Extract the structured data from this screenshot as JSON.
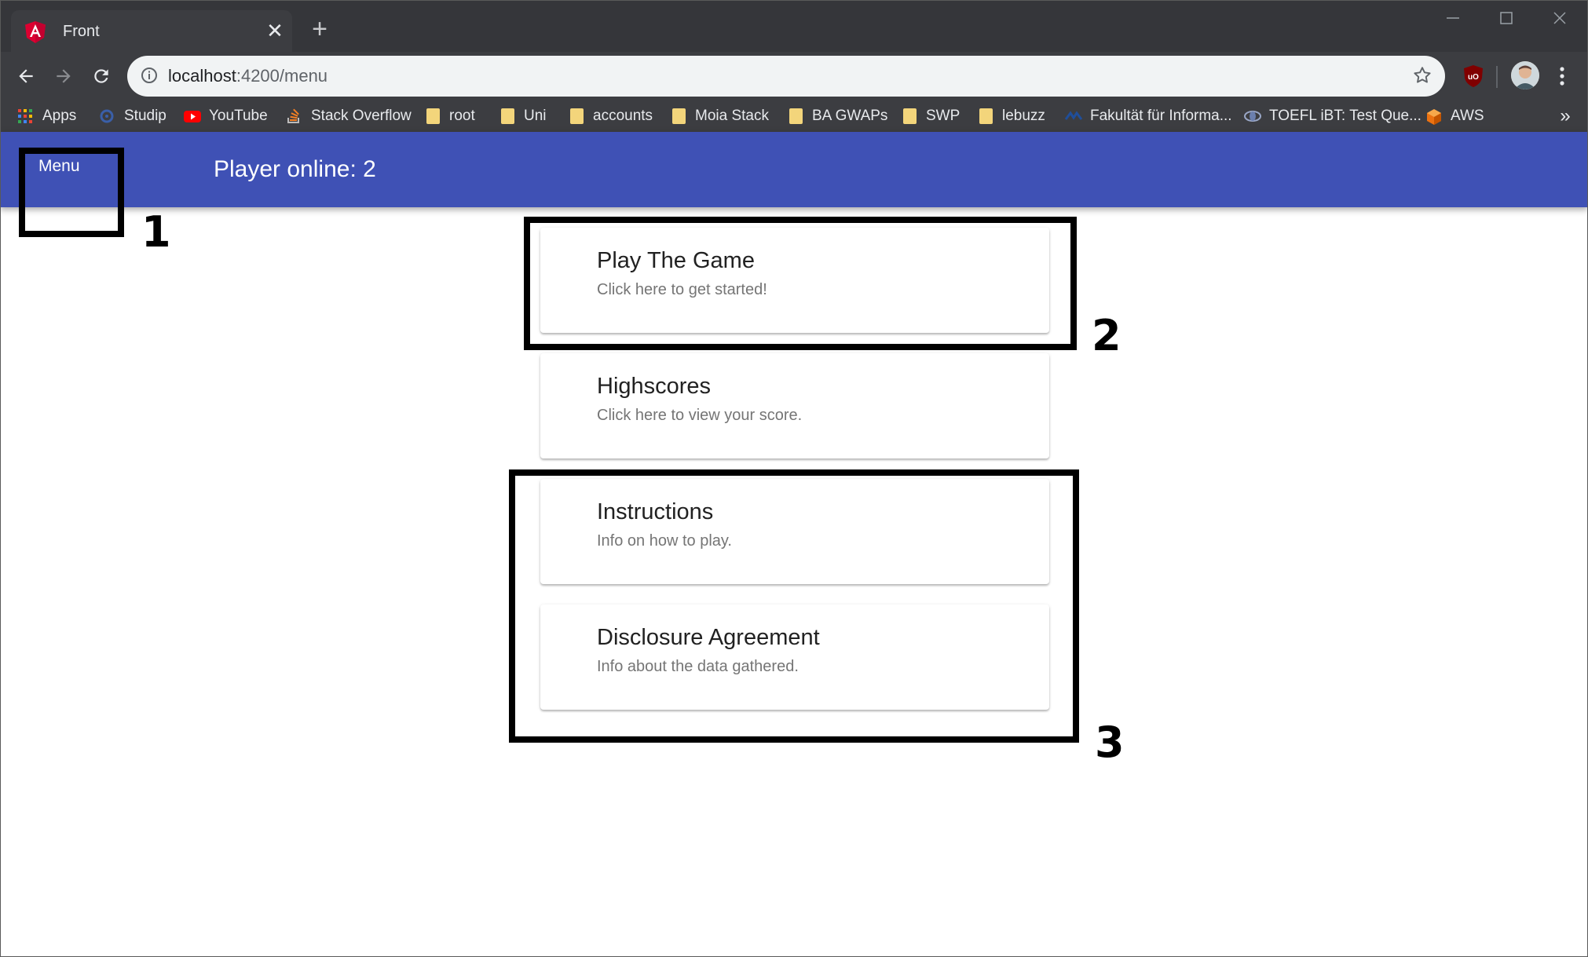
{
  "browser": {
    "tab_title": "Front",
    "url_host": "localhost",
    "url_path": ":4200/menu",
    "new_tab_symbol": "+",
    "close_symbol": "✕"
  },
  "bookmarks": [
    {
      "label": "Apps",
      "icon": "apps-grid-icon"
    },
    {
      "label": "Studip",
      "icon": "studip-icon"
    },
    {
      "label": "YouTube",
      "icon": "youtube-icon"
    },
    {
      "label": "Stack Overflow",
      "icon": "stackoverflow-icon"
    },
    {
      "label": "root",
      "icon": "folder-icon"
    },
    {
      "label": "Uni",
      "icon": "folder-icon"
    },
    {
      "label": "accounts",
      "icon": "folder-icon"
    },
    {
      "label": "Moia Stack",
      "icon": "folder-icon"
    },
    {
      "label": "BA GWAPs",
      "icon": "folder-icon"
    },
    {
      "label": "SWP",
      "icon": "folder-icon"
    },
    {
      "label": "lebuzz",
      "icon": "folder-icon"
    },
    {
      "label": "Fakultät für Informa...",
      "icon": "faculty-icon"
    },
    {
      "label": "TOEFL iBT: Test Que...",
      "icon": "toefl-icon"
    },
    {
      "label": "AWS",
      "icon": "aws-icon"
    }
  ],
  "app": {
    "menu_label": "Menu",
    "player_online": "Player online: 2",
    "header_color": "#3f51b5"
  },
  "cards": [
    {
      "title": "Play The Game",
      "subtitle": "Click here to get started!"
    },
    {
      "title": "Highscores",
      "subtitle": "Click here to view your score."
    },
    {
      "title": "Instructions",
      "subtitle": "Info on how to play."
    },
    {
      "title": "Disclosure Agreement",
      "subtitle": "Info about the data gathered."
    }
  ],
  "annotations": {
    "one": "1",
    "two": "2",
    "three": "3"
  }
}
